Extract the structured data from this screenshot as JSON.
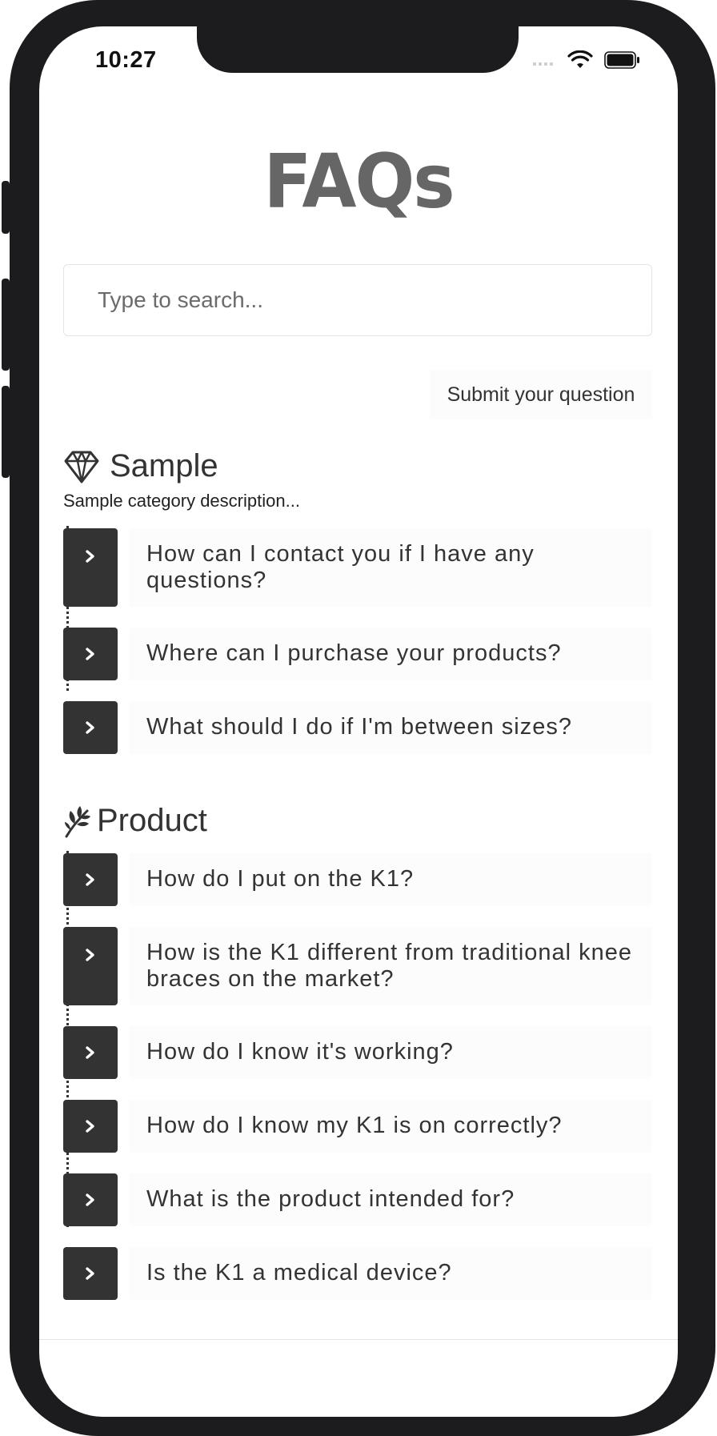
{
  "status_bar": {
    "time": "10:27"
  },
  "page": {
    "title": "FAQs"
  },
  "search": {
    "placeholder": "Type to search..."
  },
  "submit_label": "Submit your question",
  "categories": [
    {
      "title": "Sample",
      "icon": "diamond-icon",
      "description": "Sample category description...",
      "questions": [
        "How can I contact you if I have any questions?",
        "Where can I purchase your products?",
        "What should I do if I'm between sizes?"
      ]
    },
    {
      "title": "Product",
      "icon": "leaf-icon",
      "questions": [
        "How do I put on the K1?",
        "How is the K1 different from traditional knee braces on the market?",
        "How do I know it's working?",
        "How do I know my K1 is on correctly?",
        "What is the product intended for?",
        "Is the K1 a medical device?"
      ]
    }
  ],
  "colors": {
    "accent": "#333333",
    "title": "#666666",
    "row_bg": "#fcfcfc"
  }
}
